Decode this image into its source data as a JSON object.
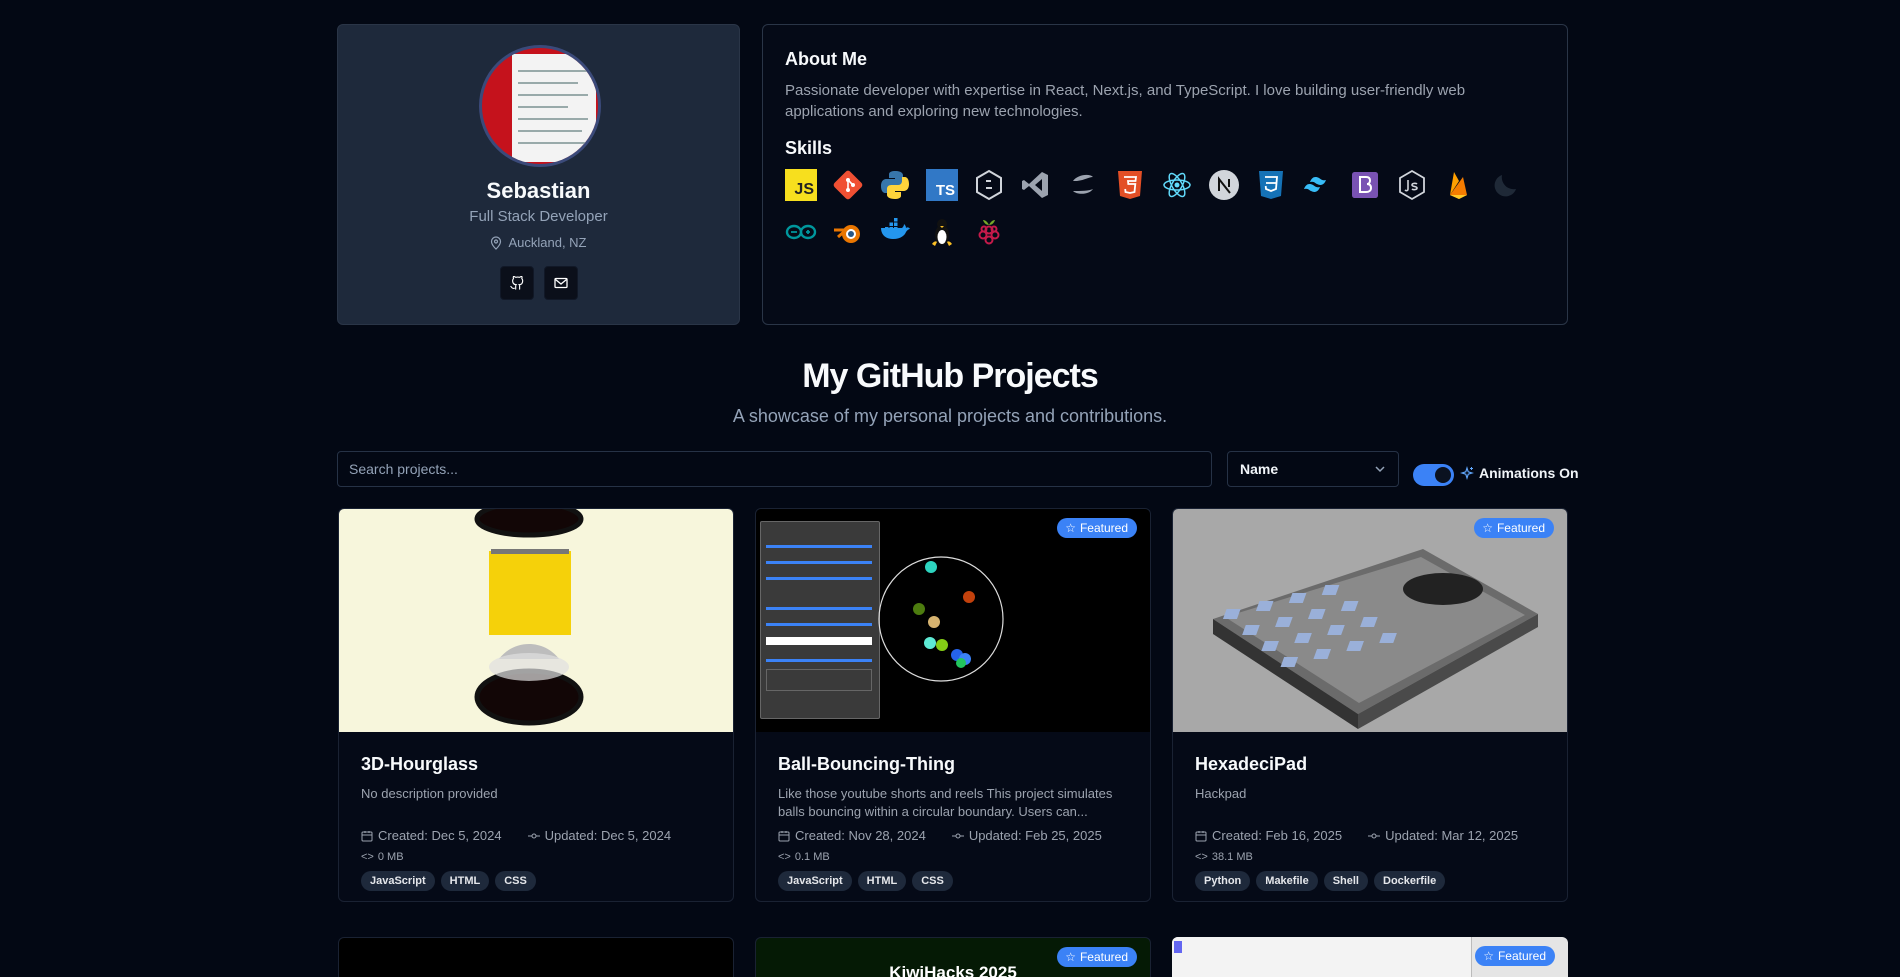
{
  "profile": {
    "name": "Sebastian",
    "role": "Full Stack Developer",
    "location": "Auckland, NZ",
    "avatar_icon": "avatar-image",
    "social": [
      {
        "icon": "github-icon"
      },
      {
        "icon": "mail-icon"
      }
    ]
  },
  "about": {
    "title": "About Me",
    "text": "Passionate developer with expertise in React, Next.js, and TypeScript. I love building user-friendly web applications and exploring new technologies.",
    "skills_title": "Skills",
    "skills": [
      "javascript-icon",
      "git-icon",
      "python-icon",
      "typescript-icon",
      "bash-icon",
      "vscode-icon",
      "swift-icon",
      "html5-icon",
      "react-icon",
      "nextjs-icon",
      "css3-icon",
      "tailwind-icon",
      "bootstrap-icon",
      "nodejs-icon",
      "firebase-icon",
      "moon-icon",
      "arduino-icon",
      "blender-icon",
      "docker-icon",
      "linux-icon",
      "raspberrypi-icon"
    ]
  },
  "projects_section": {
    "title": "My GitHub Projects",
    "subtitle": "A showcase of my personal projects and contributions.",
    "search_placeholder": "Search projects...",
    "sort_value": "Name",
    "animations_label": "Animations On",
    "animations_on": true,
    "featured_label": "Featured"
  },
  "projects": [
    {
      "name": "3D-Hourglass",
      "description": "No description provided",
      "featured": false,
      "created": "Created: Dec 5, 2024",
      "updated": "Updated: Dec 5, 2024",
      "size": "0 MB",
      "tags": [
        "JavaScript",
        "HTML",
        "CSS"
      ]
    },
    {
      "name": "Ball-Bouncing-Thing",
      "description": "Like those youtube shorts and reels This project simulates balls bouncing within a circular boundary. Users can...",
      "featured": true,
      "created": "Created: Nov 28, 2024",
      "updated": "Updated: Feb 25, 2025",
      "size": "0.1 MB",
      "tags": [
        "JavaScript",
        "HTML",
        "CSS"
      ]
    },
    {
      "name": "HexadeciPad",
      "description": "Hackpad",
      "featured": true,
      "created": "Created: Feb 16, 2025",
      "updated": "Updated: Mar 12, 2025",
      "size": "38.1 MB",
      "tags": [
        "Python",
        "Makefile",
        "Shell",
        "Dockerfile"
      ]
    }
  ],
  "projects_row2": [
    {
      "featured": false
    },
    {
      "featured": true,
      "banner": "KiwiHacks 2025"
    },
    {
      "featured": true
    }
  ],
  "colors": {
    "accent": "#3b82f6",
    "background": "#030814",
    "card": "#1e293b"
  }
}
